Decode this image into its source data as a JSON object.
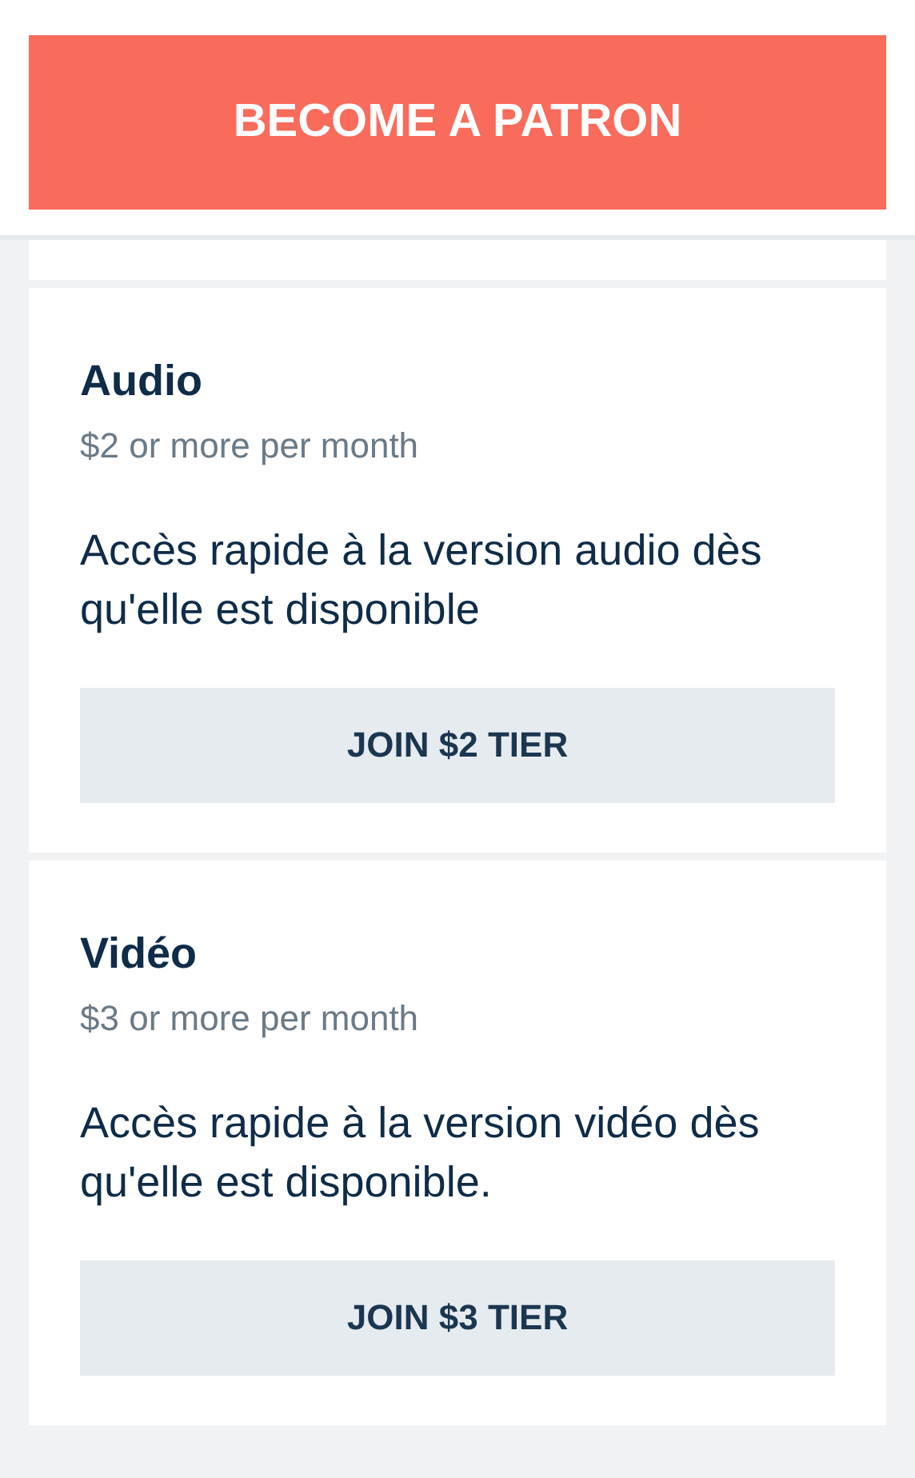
{
  "cta_button": "BECOME A PATRON",
  "tiers": [
    {
      "title": "Audio",
      "price": "$2 or more per month",
      "description": "Accès rapide à la version audio dès qu'elle est disponible",
      "button": "JOIN $2 TIER"
    },
    {
      "title": "Vidéo",
      "price": "$3 or more per month",
      "description": "Accès rapide à la version vidéo dès qu'elle est disponible.",
      "button": "JOIN $3 TIER"
    }
  ]
}
